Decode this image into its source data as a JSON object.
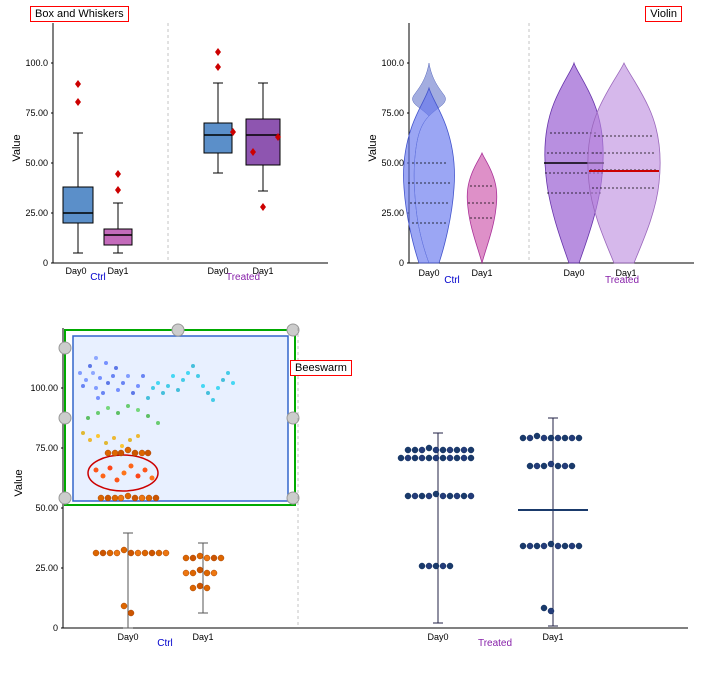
{
  "charts": {
    "box_whiskers": {
      "title": "Box and Whiskers",
      "y_label": "Value",
      "groups": [
        {
          "name": "Ctrl",
          "days": [
            "Day0",
            "Day1"
          ]
        },
        {
          "name": "Treated",
          "days": [
            "Day0",
            "Day1"
          ]
        }
      ]
    },
    "violin": {
      "title": "Violin",
      "y_label": "Value",
      "groups": [
        {
          "name": "Ctrl",
          "days": [
            "Day0",
            "Day1"
          ]
        },
        {
          "name": "Treated",
          "days": [
            "Day0",
            "Day1"
          ]
        }
      ]
    },
    "beeswarm": {
      "title": "Beeswarm",
      "y_label": "Value",
      "groups": [
        {
          "name": "Ctrl",
          "days": [
            "Day0",
            "Day1"
          ]
        },
        {
          "name": "Treated",
          "days": [
            "Day0",
            "Day1"
          ]
        }
      ]
    }
  }
}
